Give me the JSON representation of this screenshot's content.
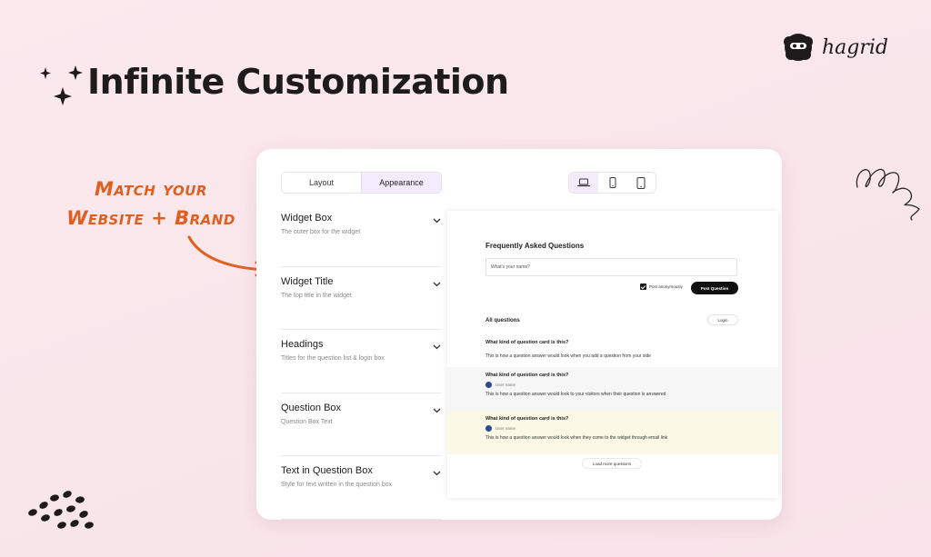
{
  "headline": "Infinite Customization",
  "brand": {
    "name": "hagrid"
  },
  "callout": {
    "line1": "Match your",
    "line2": "Website + Brand",
    "color": "#e05f1f"
  },
  "tabs": [
    {
      "label": "Layout",
      "active": false
    },
    {
      "label": "Appearance",
      "active": true
    }
  ],
  "device_toggle": [
    {
      "icon": "laptop-icon",
      "active": true
    },
    {
      "icon": "phone-icon",
      "active": false
    },
    {
      "icon": "tablet-icon",
      "active": false
    }
  ],
  "settings": [
    {
      "title": "Widget Box",
      "desc": "The outer box for the widget"
    },
    {
      "title": "Widget Title",
      "desc": "The top title in the widget"
    },
    {
      "title": "Headings",
      "desc": "Titles for the question list & login box"
    },
    {
      "title": "Question Box",
      "desc": "Question Box Text"
    },
    {
      "title": "Text in Question Box",
      "desc": "Style for text written in the question box"
    }
  ],
  "preview": {
    "title": "Frequently Asked Questions",
    "name_placeholder": "What's your name?",
    "anonymous_label": "Post anonymously",
    "anonymous_checked": true,
    "post_button": "Post Question",
    "all_questions": "All questions",
    "login_button": "Login",
    "questions": [
      {
        "title": "What kind of question card is this?",
        "user": "",
        "answer": "This is how a question answer would look when you add a question from your side",
        "bg": "#ffffff"
      },
      {
        "title": "What kind of question card is this?",
        "user": "User name",
        "answer": "This is how a question answer would look to your visitors when their question is answered",
        "bg": "#f6f6f6"
      },
      {
        "title": "What kind of question card is this?",
        "user": "User name",
        "answer": "This is how a question answer would look when they come to the widget through email link",
        "bg": "#fbf9e6"
      }
    ],
    "load_more": "Load more questions"
  }
}
